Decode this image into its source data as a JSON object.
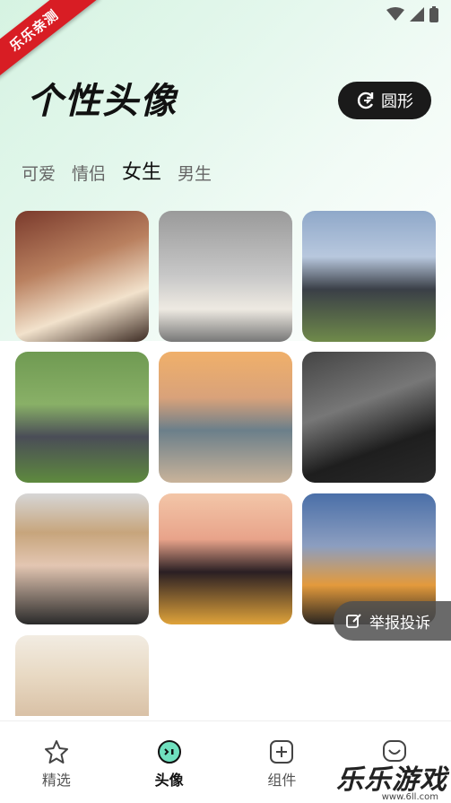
{
  "ribbon": {
    "text": "乐乐亲测"
  },
  "header": {
    "title": "个性头像",
    "shape_toggle_label": "圆形"
  },
  "tabs": [
    {
      "label": "可爱",
      "active": false
    },
    {
      "label": "情侣",
      "active": false
    },
    {
      "label": "女生",
      "active": true
    },
    {
      "label": "男生",
      "active": false
    }
  ],
  "report": {
    "label": "举报投诉"
  },
  "nav": [
    {
      "label": "精选",
      "icon": "star-icon",
      "active": false
    },
    {
      "label": "头像",
      "icon": "avatar-face-icon",
      "active": true
    },
    {
      "label": "组件",
      "icon": "plus-square-icon",
      "active": false
    },
    {
      "label": "",
      "icon": "heart-chat-icon",
      "active": false
    }
  ],
  "watermark": {
    "text": "乐乐游戏",
    "url": "www.6ll.com"
  },
  "colors": {
    "accent": "#5fd6b0",
    "ribbon": "#d81d24"
  }
}
